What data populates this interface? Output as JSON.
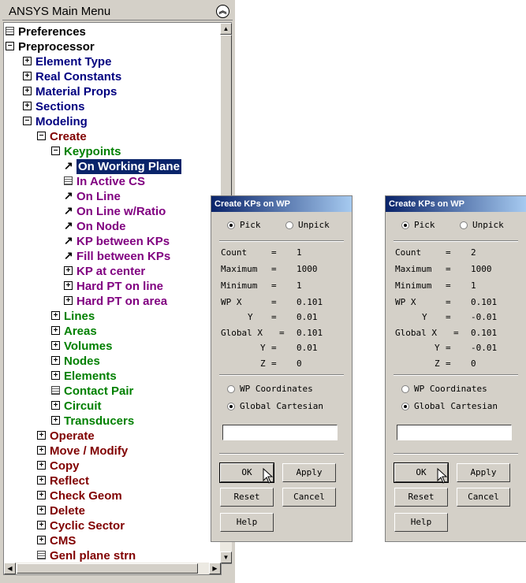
{
  "menu": {
    "title": "ANSYS Main Menu",
    "collapse_icon": "double-chevron-up-icon",
    "items": [
      {
        "label": "Preferences",
        "icon": "page",
        "color": "black"
      },
      {
        "label": "Preprocessor",
        "icon": "minus",
        "color": "black"
      },
      {
        "label": "Element Type",
        "icon": "plus",
        "color": "navy"
      },
      {
        "label": "Real Constants",
        "icon": "plus",
        "color": "navy"
      },
      {
        "label": "Material Props",
        "icon": "plus",
        "color": "navy"
      },
      {
        "label": "Sections",
        "icon": "plus",
        "color": "navy"
      },
      {
        "label": "Modeling",
        "icon": "minus",
        "color": "navy"
      },
      {
        "label": "Create",
        "icon": "minus",
        "color": "maroon"
      },
      {
        "label": "Keypoints",
        "icon": "minus",
        "color": "green"
      },
      {
        "label": "On Working Plane",
        "icon": "arrow",
        "color": "white",
        "selected": true
      },
      {
        "label": "In Active CS",
        "icon": "page",
        "color": "purple"
      },
      {
        "label": "On Line",
        "icon": "arrow",
        "color": "purple"
      },
      {
        "label": "On Line w/Ratio",
        "icon": "arrow",
        "color": "purple"
      },
      {
        "label": "On Node",
        "icon": "arrow",
        "color": "purple"
      },
      {
        "label": "KP between KPs",
        "icon": "arrow",
        "color": "purple"
      },
      {
        "label": "Fill between KPs",
        "icon": "arrow",
        "color": "purple"
      },
      {
        "label": "KP at center",
        "icon": "plus",
        "color": "purple"
      },
      {
        "label": "Hard PT on line",
        "icon": "plus",
        "color": "purple"
      },
      {
        "label": "Hard PT on area",
        "icon": "plus",
        "color": "purple"
      },
      {
        "label": "Lines",
        "icon": "plus",
        "color": "green"
      },
      {
        "label": "Areas",
        "icon": "plus",
        "color": "green"
      },
      {
        "label": "Volumes",
        "icon": "plus",
        "color": "green"
      },
      {
        "label": "Nodes",
        "icon": "plus",
        "color": "green"
      },
      {
        "label": "Elements",
        "icon": "plus",
        "color": "green"
      },
      {
        "label": "Contact Pair",
        "icon": "page",
        "color": "green"
      },
      {
        "label": "Circuit",
        "icon": "plus",
        "color": "green"
      },
      {
        "label": "Transducers",
        "icon": "plus",
        "color": "green"
      },
      {
        "label": "Operate",
        "icon": "plus",
        "color": "maroon"
      },
      {
        "label": "Move / Modify",
        "icon": "plus",
        "color": "maroon"
      },
      {
        "label": "Copy",
        "icon": "plus",
        "color": "maroon"
      },
      {
        "label": "Reflect",
        "icon": "plus",
        "color": "maroon"
      },
      {
        "label": "Check Geom",
        "icon": "plus",
        "color": "maroon"
      },
      {
        "label": "Delete",
        "icon": "plus",
        "color": "maroon"
      },
      {
        "label": "Cyclic Sector",
        "icon": "plus",
        "color": "maroon"
      },
      {
        "label": "CMS",
        "icon": "plus",
        "color": "maroon"
      },
      {
        "label": "Genl plane strn",
        "icon": "page",
        "color": "maroon"
      }
    ]
  },
  "dialogs": [
    {
      "title": "Create KPs on WP",
      "pick": "Pick",
      "unpick": "Unpick",
      "count_label": "Count",
      "count": "1",
      "maximum_label": "Maximum",
      "maximum": "1000",
      "minimum_label": "Minimum",
      "minimum": "1",
      "wpx_label": "WP X",
      "wpx": "0.101",
      "y_label": "Y",
      "wpy": "0.01",
      "globalx_label": "Global X",
      "gx": "0.101",
      "gy": "0.01",
      "z_label": "Z",
      "gz": "0",
      "eq": "=",
      "wp_coords": "WP Coordinates",
      "global_cart": "Global Cartesian",
      "input_value": "",
      "ok": "OK",
      "apply": "Apply",
      "reset": "Reset",
      "cancel": "Cancel",
      "help": "Help"
    },
    {
      "title": "Create KPs on WP",
      "pick": "Pick",
      "unpick": "Unpick",
      "count_label": "Count",
      "count": "2",
      "maximum_label": "Maximum",
      "maximum": "1000",
      "minimum_label": "Minimum",
      "minimum": "1",
      "wpx_label": "WP X",
      "wpx": "0.101",
      "y_label": "Y",
      "wpy": "-0.01",
      "globalx_label": "Global X",
      "gx": "0.101",
      "gy": "-0.01",
      "z_label": "Z",
      "gz": "0",
      "eq": "=",
      "wp_coords": "WP Coordinates",
      "global_cart": "Global Cartesian",
      "input_value": "",
      "ok": "OK",
      "apply": "Apply",
      "reset": "Reset",
      "cancel": "Cancel",
      "help": "Help"
    }
  ]
}
